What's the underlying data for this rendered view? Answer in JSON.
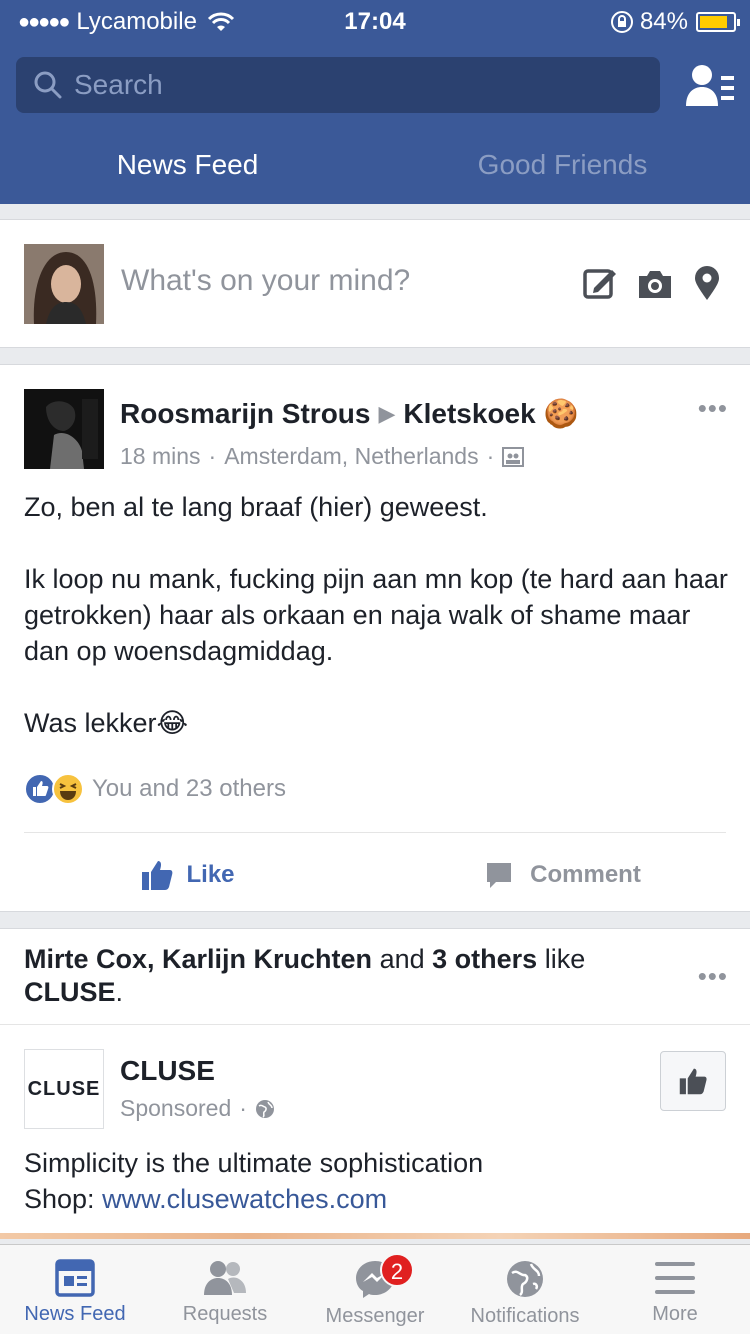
{
  "status_bar": {
    "signal": "●●●●●",
    "carrier": "Lycamobile",
    "time": "17:04",
    "battery_percent": "84%",
    "battery_level": 0.84
  },
  "header": {
    "search_placeholder": "Search",
    "tabs": [
      {
        "label": "News Feed",
        "active": true
      },
      {
        "label": "Good Friends",
        "active": false
      }
    ]
  },
  "composer": {
    "prompt": "What's on your mind?"
  },
  "post": {
    "author": "Roosmarijn Strous",
    "separator": "▶",
    "group": "Kletskoek",
    "group_emoji": "🍪",
    "time": "18 mins",
    "dot": "·",
    "location": "Amsterdam, Netherlands",
    "more": "•••",
    "body": [
      "Zo, ben al te lang braaf (hier) geweest.",
      "Ik loop nu mank, fucking pijn aan mn kop (te hard aan haar getrokken) haar als orkaan en naja walk of shame maar dan op woensdagmiddag.",
      "Was lekker😂"
    ],
    "reactions_text": "You and 23 others",
    "like_label": "Like",
    "comment_label": "Comment"
  },
  "sponsored": {
    "people": "Mirte Cox, Karlijn Kruchten",
    "and": "and",
    "others": "3 others",
    "like_word": "like",
    "page": "CLUSE",
    "period": ".",
    "more": "•••",
    "logo_text": "CLUSE",
    "advertiser": "CLUSE",
    "sponsored_label": "Sponsored",
    "text": "Simplicity is the ultimate sophistication",
    "shop_label": "Shop:",
    "link": "www.clusewatches.com"
  },
  "tabbar": {
    "items": [
      {
        "label": "News Feed",
        "active": true
      },
      {
        "label": "Requests"
      },
      {
        "label": "Messenger",
        "badge": "2"
      },
      {
        "label": "Notifications"
      },
      {
        "label": "More"
      }
    ]
  },
  "colors": {
    "brand": "#3b5998",
    "link": "#385898",
    "accent": "#4267b2",
    "badge": "#e02020",
    "battery": "#ffcc00"
  }
}
